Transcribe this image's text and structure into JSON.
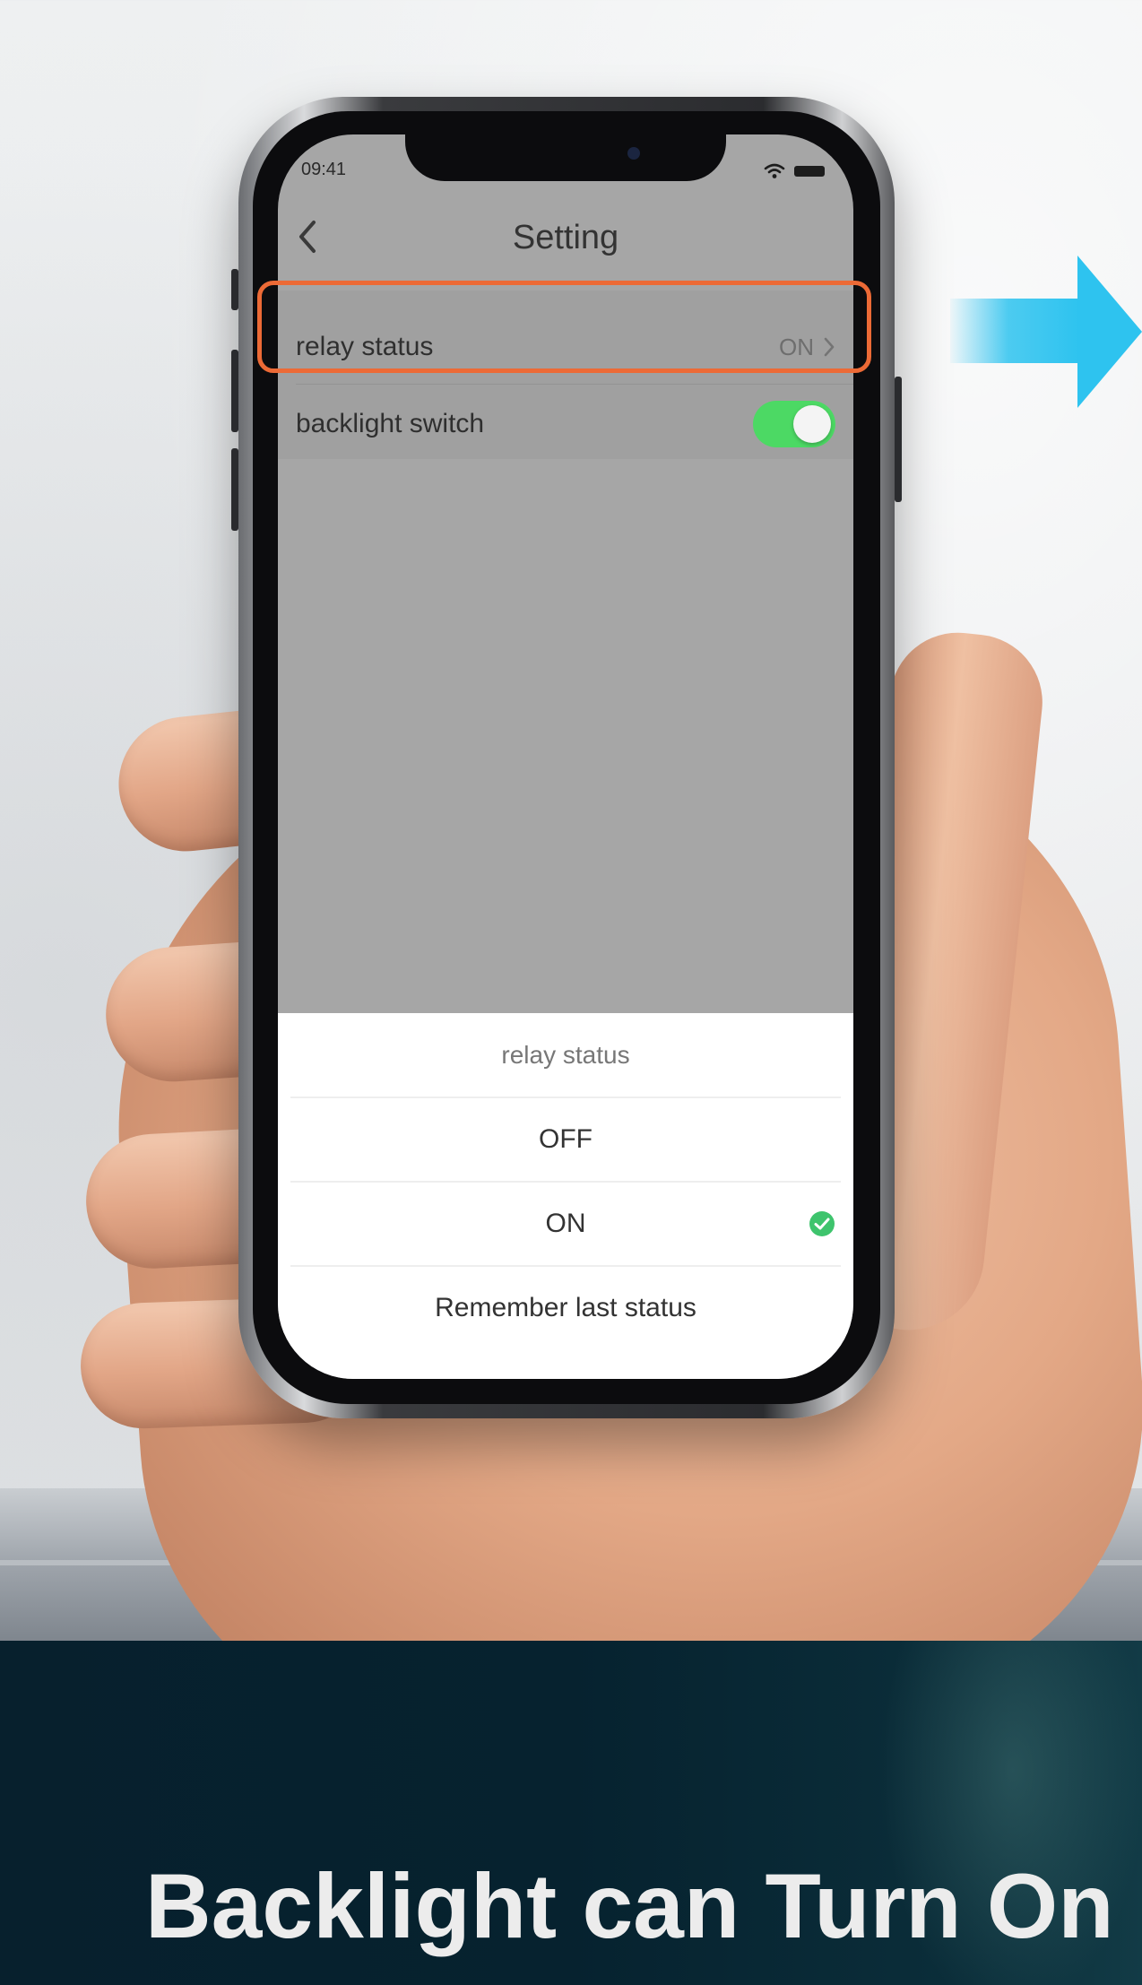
{
  "status_bar": {
    "time": "09:41"
  },
  "nav": {
    "title": "Setting",
    "back_icon": "chevron-left-icon"
  },
  "settings": [
    {
      "label": "relay status",
      "value": "ON",
      "icon": "chevron-right-icon"
    },
    {
      "label": "backlight switch",
      "toggle_on": true
    }
  ],
  "sheet": {
    "title": "relay status",
    "options": [
      {
        "label": "OFF",
        "selected": false
      },
      {
        "label": "ON",
        "selected": true
      },
      {
        "label": "Remember last status",
        "selected": false
      }
    ]
  },
  "banner": {
    "headline": "Backlight can Turn On"
  },
  "colors": {
    "highlight": "#ec6a36",
    "toggle_on": "#4cd964",
    "check": "#3ec46d",
    "arrow": "#2ec3ef",
    "banner_bg": "#07202d"
  }
}
